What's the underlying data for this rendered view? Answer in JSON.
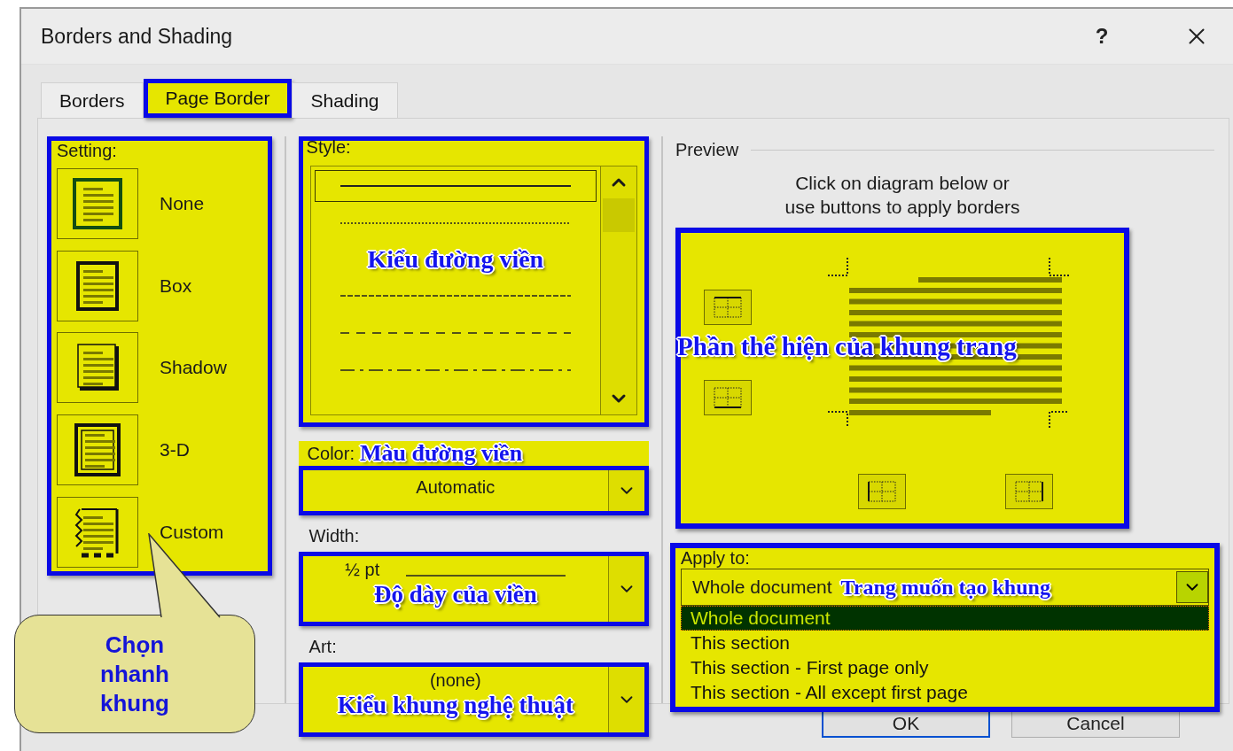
{
  "window": {
    "title": "Borders and Shading",
    "help": "?"
  },
  "tabs": [
    {
      "label": "Borders",
      "selected": false
    },
    {
      "label": "Page Border",
      "selected": true
    },
    {
      "label": "Shading",
      "selected": false
    }
  ],
  "setting": {
    "label": "Setting:",
    "items": [
      {
        "label": "None",
        "kind": "none"
      },
      {
        "label": "Box",
        "kind": "box"
      },
      {
        "label": "Shadow",
        "kind": "shadow"
      },
      {
        "label": "3-D",
        "kind": "double"
      },
      {
        "label": "Custom",
        "kind": "custom"
      }
    ]
  },
  "style": {
    "label": "Style:",
    "annotation": "Kiểu đường viền",
    "items": [
      {
        "kind": "solid",
        "selected": true
      },
      {
        "kind": "dotted",
        "selected": false
      },
      {
        "kind": "dashed-fine",
        "selected": false
      },
      {
        "kind": "dashed",
        "selected": false
      },
      {
        "kind": "dash-dot",
        "selected": false
      }
    ]
  },
  "color": {
    "label": "Color:",
    "annotation": "Màu đường viền",
    "value": "Automatic"
  },
  "width": {
    "label": "Width:",
    "annotation": "Độ dày của viền",
    "value": "½ pt"
  },
  "art": {
    "label": "Art:",
    "annotation": "Kiểu khung nghệ thuật",
    "value": "(none)"
  },
  "preview": {
    "legend": "Preview",
    "hint": "Click on diagram below or\nuse buttons to apply borders",
    "annotation": "Phần thể hiện của khung trang"
  },
  "apply": {
    "label": "Apply to:",
    "value": "Whole document",
    "annotation": "Trang muốn tạo khung",
    "options": [
      {
        "label": "Whole document",
        "selected": true
      },
      {
        "label": "This section",
        "selected": false
      },
      {
        "label": "This section - First page only",
        "selected": false
      },
      {
        "label": "This section - All except first page",
        "selected": false
      }
    ]
  },
  "callout": {
    "text": "Chọn nhanh khung"
  },
  "buttons": [
    {
      "label": "OK",
      "kind": "default"
    },
    {
      "label": "Cancel",
      "kind": "normal"
    }
  ]
}
